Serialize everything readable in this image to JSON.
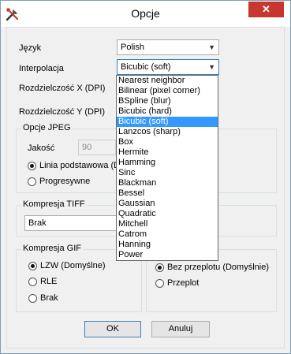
{
  "window": {
    "title": "Opcje",
    "close_glyph": "✕"
  },
  "language": {
    "label": "Język",
    "value": "Polish"
  },
  "interpolation": {
    "label": "Interpolacja",
    "value": "Bicubic (soft)"
  },
  "resolution_x": {
    "label": "Rozdzielczość X (DPI)"
  },
  "resolution_y": {
    "label": "Rozdzielczość Y (DPI)"
  },
  "jpeg": {
    "title": "Opcje JPEG",
    "quality_label": "Jakość",
    "quality_value": "90",
    "baseline_label": "Linia podstawowa (D",
    "progressive_label": "Progresywne"
  },
  "tiff": {
    "title": "Kompresja TIFF",
    "value": "Brak"
  },
  "gif": {
    "title": "Kompresja GIF",
    "options": [
      "LZW (Domyślne)",
      "RLE",
      "Brak"
    ],
    "selected": 0
  },
  "interlace": {
    "options": [
      "Bez przeplotu (Domyślnie)",
      "Przeplot"
    ],
    "selected": 0
  },
  "buttons": {
    "ok": "OK",
    "cancel": "Anuluj"
  },
  "dropdown": {
    "items": [
      "Nearest neighbor",
      "Bilinear (pixel corner)",
      "BSpline (blur)",
      "Bicubic (hard)",
      "Bicubic (soft)",
      "Lanzcos (sharp)",
      "Box",
      "Hermite",
      "Hamming",
      "Sinc",
      "Blackman",
      "Bessel",
      "Gaussian",
      "Quadratic",
      "Mitchell",
      "Catrom",
      "Hanning",
      "Power"
    ],
    "selected_index": 4
  },
  "colors": {
    "selection": "#3399ff",
    "close": "#c7372f"
  }
}
